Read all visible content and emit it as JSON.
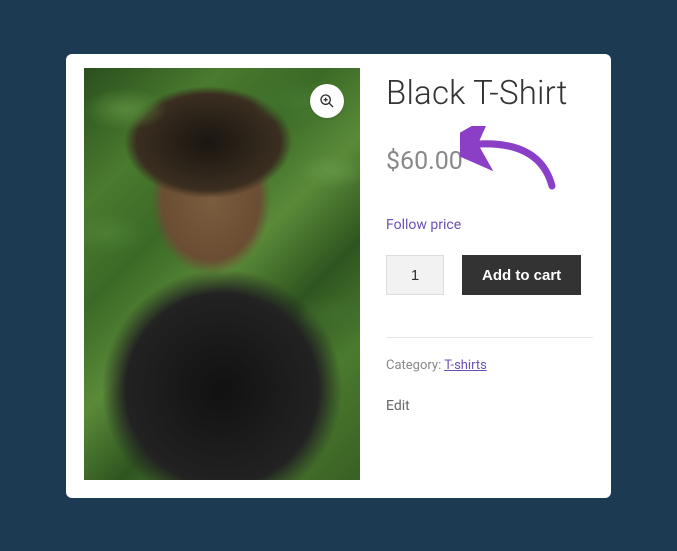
{
  "product": {
    "title": "Black T-Shirt",
    "price": "$60.00",
    "follow_price_label": "Follow price",
    "quantity": "1",
    "add_to_cart_label": "Add to cart",
    "category_label": "Category: ",
    "category_value": "T-shirts",
    "edit_label": "Edit"
  },
  "annotation": {
    "arrow_color": "#8b3fc7"
  }
}
